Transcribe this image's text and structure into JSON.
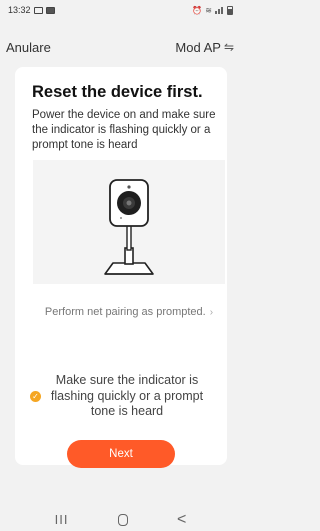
{
  "status_bar": {
    "time": "13:32"
  },
  "nav": {
    "cancel": "Anulare",
    "mode": "Mod AP",
    "mode_icon": "swap-icon"
  },
  "card": {
    "title": "Reset the device first.",
    "description": "Power the device on and make sure the indicator is flashing quickly or a prompt tone is heard",
    "illustration": "camera-icon",
    "pairing_link": "Perform net pairing as prompted.",
    "confirm_text": "Make sure the indicator is flashing quickly or a prompt tone is heard",
    "next_label": "Next"
  },
  "colors": {
    "accent": "#ff5a28",
    "check": "#f5a623",
    "background": "#f2f2f2"
  },
  "system_nav": {
    "recent": "III",
    "back": "<"
  }
}
